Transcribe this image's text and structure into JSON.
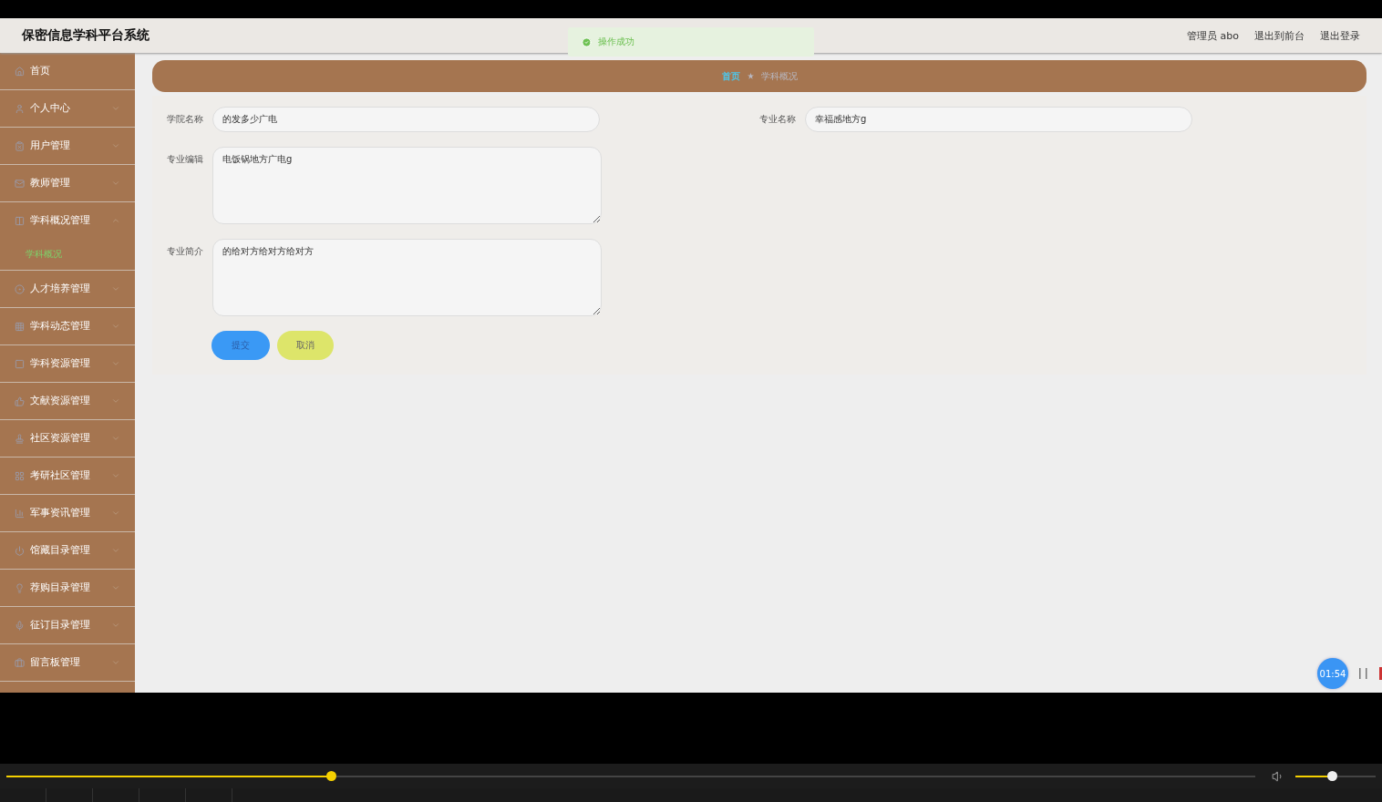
{
  "header": {
    "title": "保密信息学科平台系统",
    "links": [
      "管理员 abo",
      "退出到前台",
      "退出登录"
    ]
  },
  "toast": {
    "text": "操作成功"
  },
  "sidebar": {
    "items": [
      {
        "label": "首页",
        "kind": "link"
      },
      {
        "label": "个人中心",
        "kind": "menu",
        "expanded": false
      },
      {
        "label": "用户管理",
        "kind": "menu",
        "expanded": false
      },
      {
        "label": "教师管理",
        "kind": "menu",
        "expanded": false
      },
      {
        "label": "学科概况管理",
        "kind": "menu",
        "expanded": true,
        "children": [
          {
            "label": "学科概况",
            "selected": true
          }
        ]
      },
      {
        "label": "人才培养管理",
        "kind": "menu",
        "expanded": false
      },
      {
        "label": "学科动态管理",
        "kind": "menu",
        "expanded": false
      },
      {
        "label": "学科资源管理",
        "kind": "menu",
        "expanded": false
      },
      {
        "label": "文献资源管理",
        "kind": "menu",
        "expanded": false
      },
      {
        "label": "社区资源管理",
        "kind": "menu",
        "expanded": false
      },
      {
        "label": "考研社区管理",
        "kind": "menu",
        "expanded": false
      },
      {
        "label": "军事资讯管理",
        "kind": "menu",
        "expanded": false
      },
      {
        "label": "馆藏目录管理",
        "kind": "menu",
        "expanded": false
      },
      {
        "label": "荐购目录管理",
        "kind": "menu",
        "expanded": false
      },
      {
        "label": "征订目录管理",
        "kind": "menu",
        "expanded": false
      },
      {
        "label": "留言板管理",
        "kind": "menu",
        "expanded": false
      }
    ]
  },
  "breadcrumb": [
    "首页",
    "学科概况"
  ],
  "form": {
    "fields": [
      {
        "label": "学院名称",
        "kind": "input",
        "value": "的发多少广电"
      },
      {
        "label": "专业名称",
        "kind": "input",
        "value": "幸福感地方g"
      },
      {
        "label": "专业编辑",
        "kind": "textarea",
        "value": "电饭锅地方广电g"
      },
      {
        "label": "专业简介",
        "kind": "textarea",
        "value": "的给对方给对方给对方"
      }
    ],
    "buttons": [
      {
        "label": "提交",
        "kind": "primary"
      },
      {
        "label": "取消",
        "kind": "secondary"
      }
    ]
  },
  "recorder": {
    "time": "01:54"
  },
  "player": {
    "progress": {
      "level": 0.26
    },
    "volume": {
      "level": 0.45
    }
  }
}
